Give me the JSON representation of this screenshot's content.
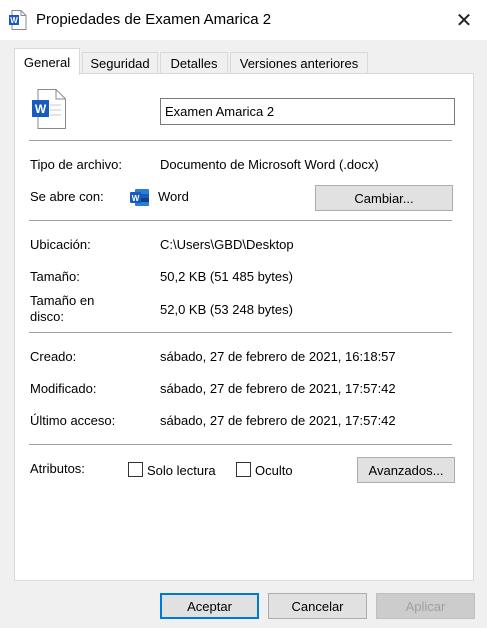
{
  "window": {
    "title": "Propiedades de Examen Amarica 2",
    "close_glyph": "✕"
  },
  "tabs": [
    {
      "label": "General",
      "active": true
    },
    {
      "label": "Seguridad",
      "active": false
    },
    {
      "label": "Detalles",
      "active": false
    },
    {
      "label": "Versiones anteriores",
      "active": false
    }
  ],
  "general": {
    "file_name": "Examen Amarica 2",
    "type_label": "Tipo de archivo:",
    "type_value": "Documento de Microsoft Word (.docx)",
    "opens_label": "Se abre con:",
    "opens_value": "Word",
    "change_button": "Cambiar...",
    "location_label": "Ubicación:",
    "location_value": "C:\\Users\\GBD\\Desktop",
    "size_label": "Tamaño:",
    "size_value": "50,2 KB (51 485 bytes)",
    "disk_size_label": "Tamaño en\ndisco:",
    "disk_size_value": "52,0 KB (53 248 bytes)",
    "created_label": "Creado:",
    "created_value": "sábado, 27 de febrero de 2021, 16:18:57",
    "modified_label": "Modificado:",
    "modified_value": "sábado, 27 de febrero de 2021, 17:57:42",
    "accessed_label": "Último acceso:",
    "accessed_value": "sábado, 27 de febrero de 2021, 17:57:42",
    "attributes_label": "Atributos:",
    "readonly_label": "Solo lectura",
    "readonly_checked": false,
    "hidden_label": "Oculto",
    "hidden_checked": false,
    "advanced_button": "Avanzados..."
  },
  "footer": {
    "ok_button": "Aceptar",
    "cancel_button": "Cancelar",
    "apply_button": "Aplicar"
  },
  "colors": {
    "word_blue": "#185abd",
    "word_dark": "#103f91",
    "accent": "#0078d7"
  }
}
